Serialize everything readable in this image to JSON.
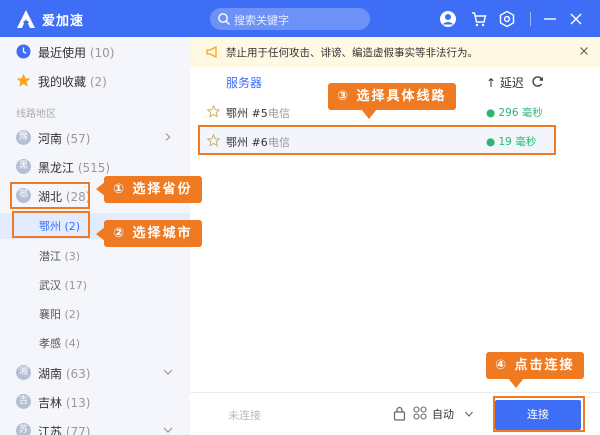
{
  "app": {
    "title": "爱加速"
  },
  "titlebar": {
    "search_placeholder": "搜索关键字"
  },
  "sidebar": {
    "recent": {
      "label": "最近使用",
      "count": "(10)"
    },
    "favorites": {
      "label": "我的收藏",
      "count": "(2)"
    },
    "section_title": "线路地区",
    "provinces": [
      {
        "label": "河南",
        "count": "(57)",
        "flag": "豫"
      },
      {
        "label": "黑龙江",
        "count": "(515)",
        "flag": "黑"
      },
      {
        "label": "湖北",
        "count": "(28)",
        "flag": "鄂"
      }
    ],
    "cities": [
      {
        "label": "鄂州",
        "count": "(2)"
      },
      {
        "label": "潜江",
        "count": "(3)"
      },
      {
        "label": "武汉",
        "count": "(17)"
      },
      {
        "label": "襄阳",
        "count": "(2)"
      },
      {
        "label": "孝感",
        "count": "(4)"
      }
    ],
    "more_provinces": [
      {
        "label": "湖南",
        "count": "(63)",
        "flag": "湘"
      },
      {
        "label": "吉林",
        "count": "(13)",
        "flag": "吉"
      },
      {
        "label": "江苏",
        "count": "(77)",
        "flag": "苏"
      }
    ]
  },
  "notice": {
    "text": "禁止用于任何攻击、诽谤、编造虚假事实等非法行为。"
  },
  "table": {
    "col_server": "服务器",
    "col_latency": "↑ 延迟",
    "rows": [
      {
        "name": "鄂州 #5",
        "isp": "电信",
        "latency": "● 296 毫秒"
      },
      {
        "name": "鄂州 #6",
        "isp": "电信",
        "latency": "● 19 毫秒"
      }
    ]
  },
  "footer": {
    "status": "未连接",
    "mode": "自动",
    "connect_label": "连接"
  },
  "annotations": {
    "step1": "① 选择省份",
    "step2": "② 选择城市",
    "step3": "③ 选择具体线路",
    "step4": "④ 点击连接"
  },
  "colors": {
    "brand": "#3d6ef5",
    "accent": "#ef7a22",
    "latency_ok": "#2bb673",
    "notice_bg": "#fff8e3"
  }
}
